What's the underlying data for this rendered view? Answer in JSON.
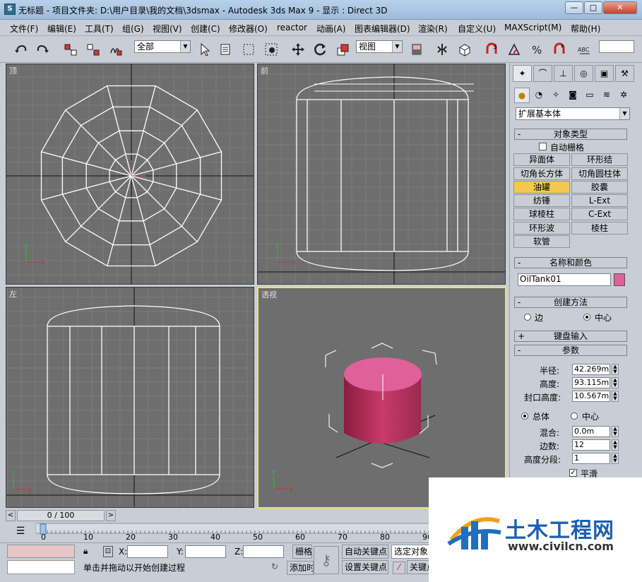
{
  "titlebar": {
    "app_icon": "S",
    "title": "无标题    - 项目文件夹: D:\\用户目录\\我的文档\\3dsmax     - Autodesk 3ds Max 9      - 显示 : Direct 3D",
    "min": "—",
    "max": "□",
    "close": "✕"
  },
  "menu": [
    "文件(F)",
    "编辑(E)",
    "工具(T)",
    "组(G)",
    "视图(V)",
    "创建(C)",
    "修改器(O)",
    "reactor",
    "动画(A)",
    "图表编辑器(D)",
    "渲染(R)",
    "自定义(U)",
    "MAXScript(M)",
    "帮助(H)"
  ],
  "toolbar": {
    "selection_filter": "全部",
    "ref_coord": "视图",
    "icons": [
      "undo-icon",
      "redo-icon",
      "select-link-icon",
      "unlink-icon",
      "bind-spacewarp-icon",
      "select-object-icon",
      "select-by-name-icon",
      "rect-region-icon",
      "window-crossing-icon",
      "move-icon",
      "rotate-icon",
      "scale-icon",
      "pivot-icon",
      "mirror-icon",
      "align-icon",
      "snap-3-icon",
      "angle-snap-icon",
      "percent-snap-icon",
      "spinner-snap-icon",
      "named-selection-icon"
    ],
    "snap_label": "3",
    "named_sel": "ABC"
  },
  "viewports": [
    {
      "label": "顶",
      "id": "top"
    },
    {
      "label": "前",
      "id": "front"
    },
    {
      "label": "左",
      "id": "left"
    },
    {
      "label": "透视",
      "id": "perspective"
    }
  ],
  "panel": {
    "tabs": [
      "create-tab-icon",
      "modify-tab-icon",
      "hierarchy-tab-icon",
      "motion-tab-icon",
      "display-tab-icon",
      "utilities-tab-icon"
    ],
    "subcats": [
      "geometry-icon",
      "shapes-icon",
      "lights-icon",
      "cameras-icon",
      "helpers-icon",
      "spacewarps-icon",
      "systems-icon"
    ],
    "category": "扩展基本体",
    "object_type": {
      "title": "对象类型",
      "autogrid": "自动栅格",
      "buttons": [
        "异面体",
        "环形结",
        "切角长方体",
        "切角圆柱体",
        "油罐",
        "胶囊",
        "纺锤",
        "L-Ext",
        "球棱柱",
        "C-Ext",
        "环形波",
        "棱柱",
        "软管"
      ],
      "selected": "油罐"
    },
    "name_color": {
      "title": "名称和颜色",
      "name": "OilTank01",
      "color": "#e0609a"
    },
    "creation": {
      "title": "创建方法",
      "edge": "边",
      "center": "中心"
    },
    "keyboard": {
      "title": "键盘输入"
    },
    "params": {
      "title": "参数",
      "radius_label": "半径:",
      "radius": "42.269m",
      "height_label": "高度:",
      "height": "93.115m",
      "cap_label": "封口高度:",
      "cap": "10.567m",
      "overall": "总体",
      "center": "中心",
      "blend_label": "混合:",
      "blend": "0.0m",
      "sides_label": "边数:",
      "sides": "12",
      "hsegs_label": "高度分段:",
      "hsegs": "1",
      "smooth": "平滑"
    }
  },
  "timeline": {
    "frame": "0 / 100",
    "ticks": [
      "0",
      "10",
      "20",
      "30",
      "40",
      "50",
      "60",
      "70",
      "80",
      "90"
    ]
  },
  "status": {
    "x": "X:",
    "y": "Y:",
    "z": "Z:",
    "grid": "栅格",
    "prompt": "单击并拖动以开始创建过程",
    "add_time": "添加时",
    "autokey": "自动关键点",
    "setkey": "设置关键点",
    "selected_obj": "选定对象",
    "key_filter": "关键点"
  },
  "watermark": {
    "brand": "土木工程网",
    "url": "www.civilcn.com"
  },
  "colors": {
    "selected_button": "#f2c94c",
    "active_viewport": "#e8e36a",
    "object": "#e0609a"
  }
}
